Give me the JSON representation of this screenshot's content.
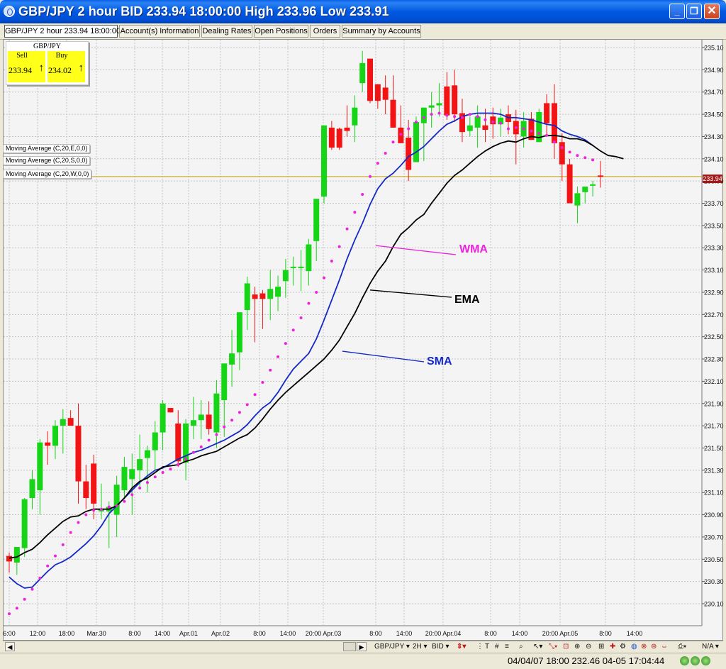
{
  "window": {
    "title": "GBP/JPY 2 hour BID 233.94 18:00:00 High 233.96 Low 233.91",
    "icon": "app-logo-icon",
    "buttons": {
      "minimize": "_",
      "maximize": "❐",
      "close": "✕"
    }
  },
  "tabs": [
    {
      "label": "GBP/JPY 2 hour 233.94 18:00:00",
      "active": true
    },
    {
      "label": "Account(s) Information"
    },
    {
      "label": "Dealing Rates"
    },
    {
      "label": "Open Positions"
    },
    {
      "label": "Orders"
    },
    {
      "label": "Summary by Accounts"
    }
  ],
  "rates_box": {
    "symbol": "GBP/JPY",
    "sell": {
      "label": "Sell",
      "value": "233.94",
      "arrow": "↑"
    },
    "buy": {
      "label": "Buy",
      "value": "234.02",
      "arrow": "↑"
    }
  },
  "indicator_tags": [
    "Moving Average (C,20,E,0,0)",
    "Moving Average (C,20,S,0,0)",
    "Moving Average (C,20,W,0,0)"
  ],
  "current_price_tag": "233.94",
  "colors": {
    "bull": "#16d416",
    "bear": "#f21414",
    "sma": "#1428c8",
    "ema": "#000000",
    "wma": "#ee22dd",
    "price_line": "#c8a000"
  },
  "chart_data": {
    "type": "candlestick",
    "symbol": "GBP/JPY",
    "timeframe": "2 hour",
    "ylim": [
      230.0,
      235.2
    ],
    "yticks": [
      "235.10",
      "234.90",
      "234.70",
      "234.50",
      "234.30",
      "234.10",
      "233.90",
      "233.70",
      "233.50",
      "233.30",
      "233.10",
      "232.90",
      "232.70",
      "232.50",
      "232.30",
      "232.10",
      "231.90",
      "231.70",
      "231.50",
      "231.30",
      "231.10",
      "230.90",
      "230.70",
      "230.50",
      "230.30",
      "230.10"
    ],
    "xticks": [
      "6:00",
      "12:00",
      "18:00",
      "Mar.30",
      "8:00",
      "14:00",
      "Apr.01",
      "Apr.02",
      "8:00",
      "14:00",
      "20:00 Apr.03",
      "8:00",
      "14:00",
      "20:00 Apr.04",
      "8:00",
      "14:00",
      "20:00 Apr.05",
      "8:00",
      "14:00"
    ],
    "candles": [
      [
        230.53,
        230.56,
        230.38,
        230.48
      ],
      [
        230.47,
        230.6,
        230.36,
        230.61
      ],
      [
        230.6,
        231.05,
        230.52,
        231.04
      ],
      [
        231.05,
        231.3,
        230.95,
        231.22
      ],
      [
        231.12,
        231.58,
        230.9,
        231.55
      ],
      [
        231.55,
        231.65,
        231.35,
        231.52
      ],
      [
        231.52,
        231.75,
        231.4,
        231.7
      ],
      [
        231.7,
        231.85,
        231.45,
        231.76
      ],
      [
        231.77,
        231.84,
        231.78,
        231.7
      ],
      [
        231.7,
        231.9,
        231.0,
        231.2
      ],
      [
        231.2,
        231.35,
        230.95,
        231.05
      ],
      [
        231.36,
        231.44,
        230.86,
        231.0
      ],
      [
        230.93,
        231.18,
        230.86,
        230.95
      ],
      [
        230.93,
        231.02,
        230.6,
        230.97
      ],
      [
        230.9,
        231.25,
        230.7,
        231.17
      ],
      [
        231.12,
        231.42,
        231.04,
        231.33
      ],
      [
        231.22,
        231.45,
        230.9,
        231.31
      ],
      [
        231.3,
        231.62,
        231.15,
        231.4
      ],
      [
        231.41,
        231.52,
        231.1,
        231.48
      ],
      [
        231.48,
        231.74,
        231.3,
        231.64
      ],
      [
        231.64,
        231.93,
        231.48,
        231.9
      ],
      [
        231.86,
        231.83,
        231.85,
        231.82
      ],
      [
        231.72,
        231.84,
        231.33,
        231.38
      ],
      [
        231.37,
        231.76,
        231.21,
        231.72
      ],
      [
        231.7,
        231.96,
        231.58,
        231.75
      ],
      [
        231.75,
        231.93,
        231.58,
        231.8
      ],
      [
        231.8,
        231.92,
        231.62,
        231.67
      ],
      [
        231.64,
        232.11,
        231.5,
        231.99
      ],
      [
        231.93,
        232.15,
        231.6,
        232.26
      ],
      [
        232.25,
        232.56,
        232.05,
        232.35
      ],
      [
        232.36,
        232.65,
        232.2,
        232.72
      ],
      [
        232.74,
        233.04,
        232.56,
        232.98
      ],
      [
        232.88,
        232.95,
        232.45,
        232.84
      ],
      [
        232.89,
        232.92,
        232.57,
        232.84
      ],
      [
        232.84,
        233.1,
        232.65,
        232.93
      ],
      [
        232.86,
        233.05,
        232.73,
        232.95
      ],
      [
        233.0,
        233.2,
        232.85,
        233.1
      ],
      [
        233.12,
        233.22,
        232.96,
        233.13
      ],
      [
        233.12,
        233.28,
        232.91,
        233.13
      ],
      [
        233.09,
        233.38,
        232.96,
        233.33
      ],
      [
        233.36,
        233.72,
        233.18,
        233.74
      ],
      [
        233.76,
        234.4,
        233.7,
        234.4
      ],
      [
        234.38,
        234.44,
        234.18,
        234.2
      ],
      [
        234.37,
        234.38,
        234.18,
        234.2
      ],
      [
        234.38,
        234.58,
        234.3,
        234.35
      ],
      [
        234.4,
        234.67,
        234.25,
        234.56
      ],
      [
        234.78,
        235.07,
        234.7,
        234.96
      ],
      [
        235.0,
        234.93,
        234.6,
        234.62
      ],
      [
        234.77,
        234.73,
        234.55,
        234.62
      ],
      [
        234.74,
        234.85,
        234.5,
        234.63
      ],
      [
        234.63,
        234.85,
        234.4,
        234.38
      ],
      [
        234.38,
        234.58,
        234.28,
        234.24
      ],
      [
        234.29,
        234.45,
        233.9,
        234.0
      ],
      [
        234.07,
        234.48,
        234.08,
        234.43
      ],
      [
        234.42,
        234.56,
        234.08,
        234.56
      ],
      [
        234.56,
        234.7,
        234.38,
        234.58
      ],
      [
        234.58,
        234.78,
        234.48,
        234.6
      ],
      [
        234.75,
        234.88,
        234.45,
        234.49
      ],
      [
        234.76,
        234.9,
        234.43,
        234.5
      ],
      [
        234.51,
        234.64,
        234.25,
        234.34
      ],
      [
        234.35,
        234.48,
        234.3,
        234.4
      ],
      [
        234.38,
        234.58,
        234.2,
        234.48
      ],
      [
        234.4,
        234.55,
        234.25,
        234.36
      ],
      [
        234.48,
        234.56,
        234.28,
        234.41
      ],
      [
        234.41,
        234.55,
        234.3,
        234.47
      ],
      [
        234.5,
        234.58,
        234.32,
        234.43
      ],
      [
        234.44,
        234.54,
        234.05,
        234.32
      ],
      [
        234.3,
        234.52,
        234.2,
        234.44
      ],
      [
        234.46,
        234.52,
        234.28,
        234.27
      ],
      [
        234.25,
        234.55,
        234.3,
        234.52
      ],
      [
        234.6,
        234.68,
        234.3,
        234.42
      ],
      [
        234.6,
        234.77,
        234.1,
        234.24
      ],
      [
        234.25,
        234.33,
        233.9,
        234.05
      ],
      [
        234.05,
        234.1,
        233.7,
        233.7
      ],
      [
        233.68,
        233.85,
        233.52,
        233.79
      ],
      [
        233.8,
        233.85,
        233.7,
        233.85
      ],
      [
        233.86,
        233.9,
        233.76,
        233.87
      ],
      [
        233.95,
        234.08,
        233.84,
        233.94
      ]
    ],
    "series": [
      {
        "name": "SMA",
        "label": "SMA",
        "color": "#1428c8",
        "label_value": 232.35,
        "values": [
          230.34,
          230.28,
          230.24,
          230.25,
          230.32,
          230.39,
          230.45,
          230.48,
          230.52,
          230.58,
          230.64,
          230.71,
          230.8,
          230.91,
          230.98,
          231.05,
          231.12,
          231.19,
          231.25,
          231.3,
          231.32,
          231.36,
          231.4,
          231.43,
          231.46,
          231.48,
          231.51,
          231.54,
          231.57,
          231.61,
          231.65,
          231.71,
          231.79,
          231.86,
          231.91,
          232.0,
          232.11,
          232.21,
          232.28,
          232.35,
          232.48,
          232.65,
          232.83,
          233.01,
          233.2,
          233.37,
          233.52,
          233.69,
          233.83,
          233.92,
          233.97,
          234.04,
          234.12,
          234.16,
          234.21,
          234.28,
          234.35,
          234.41,
          234.44,
          234.48,
          234.5,
          234.51,
          234.51,
          234.51,
          234.5,
          234.47,
          234.47,
          234.46,
          234.45,
          234.43,
          234.41,
          234.4,
          234.35,
          234.32,
          234.3,
          234.27,
          234.22
        ]
      },
      {
        "name": "EMA",
        "label": "EMA",
        "color": "#000000",
        "label_value": 232.92,
        "values": [
          230.51,
          230.52,
          230.56,
          230.59,
          230.65,
          230.72,
          230.78,
          230.84,
          230.88,
          230.89,
          230.93,
          230.95,
          230.95,
          230.95,
          230.98,
          231.05,
          231.14,
          231.2,
          231.23,
          231.28,
          231.33,
          231.34,
          231.35,
          231.38,
          231.4,
          231.43,
          231.45,
          231.47,
          231.51,
          231.55,
          231.59,
          231.62,
          231.68,
          231.76,
          231.85,
          231.93,
          232.0,
          232.06,
          232.12,
          232.18,
          232.24,
          232.3,
          232.38,
          232.47,
          232.59,
          232.71,
          232.85,
          232.98,
          233.09,
          233.18,
          233.31,
          233.42,
          233.48,
          233.55,
          233.6,
          233.7,
          233.79,
          233.88,
          233.95,
          234.0,
          234.06,
          234.12,
          234.17,
          234.21,
          234.24,
          234.26,
          234.25,
          234.28,
          234.3,
          234.29,
          234.31,
          234.31,
          234.3,
          234.28,
          234.28,
          234.26,
          234.22,
          234.17,
          234.13,
          234.12,
          234.1
        ]
      },
      {
        "name": "WMA",
        "label": "WMA",
        "color": "#ee22dd",
        "label_value": 233.32,
        "dotted": true,
        "values": [
          230.01,
          230.06,
          230.14,
          230.23,
          230.33,
          230.44,
          230.53,
          230.63,
          230.74,
          230.83,
          230.9,
          230.94,
          230.95,
          230.97,
          230.98,
          231.02,
          231.08,
          231.14,
          231.19,
          231.24,
          231.28,
          231.31,
          231.35,
          231.4,
          231.46,
          231.51,
          231.57,
          231.62,
          231.69,
          231.75,
          231.82,
          231.89,
          231.98,
          232.09,
          232.2,
          232.32,
          232.44,
          232.56,
          232.67,
          232.8,
          232.9,
          233.03,
          233.18,
          233.31,
          233.47,
          233.62,
          233.78,
          233.94,
          234.06,
          234.15,
          234.25,
          234.32,
          234.37,
          234.43,
          234.47,
          234.5,
          234.51,
          234.49,
          234.48,
          234.47,
          234.5,
          234.48,
          234.45,
          234.43,
          234.42,
          234.37,
          234.38,
          234.37,
          234.35,
          234.33,
          234.31,
          234.25,
          234.2,
          234.16,
          234.13,
          234.11,
          234.09
        ]
      }
    ]
  },
  "toolbar": {
    "symbol": "GBP/JPY ▾",
    "period": "2H ▾",
    "price": "BID ▾",
    "icons": [
      "candle-type-icon",
      "draw-line-icon",
      "grid-icon",
      "zoom-icon",
      "cursor-icon",
      "crosshair-icon",
      "zoom-in-icon",
      "zoom-out-icon",
      "indicator-icon",
      "print-icon"
    ],
    "na": "N/A ▾"
  },
  "status": {
    "text": "04/04/07 18:00   232.46   04-05 17:04:44"
  }
}
